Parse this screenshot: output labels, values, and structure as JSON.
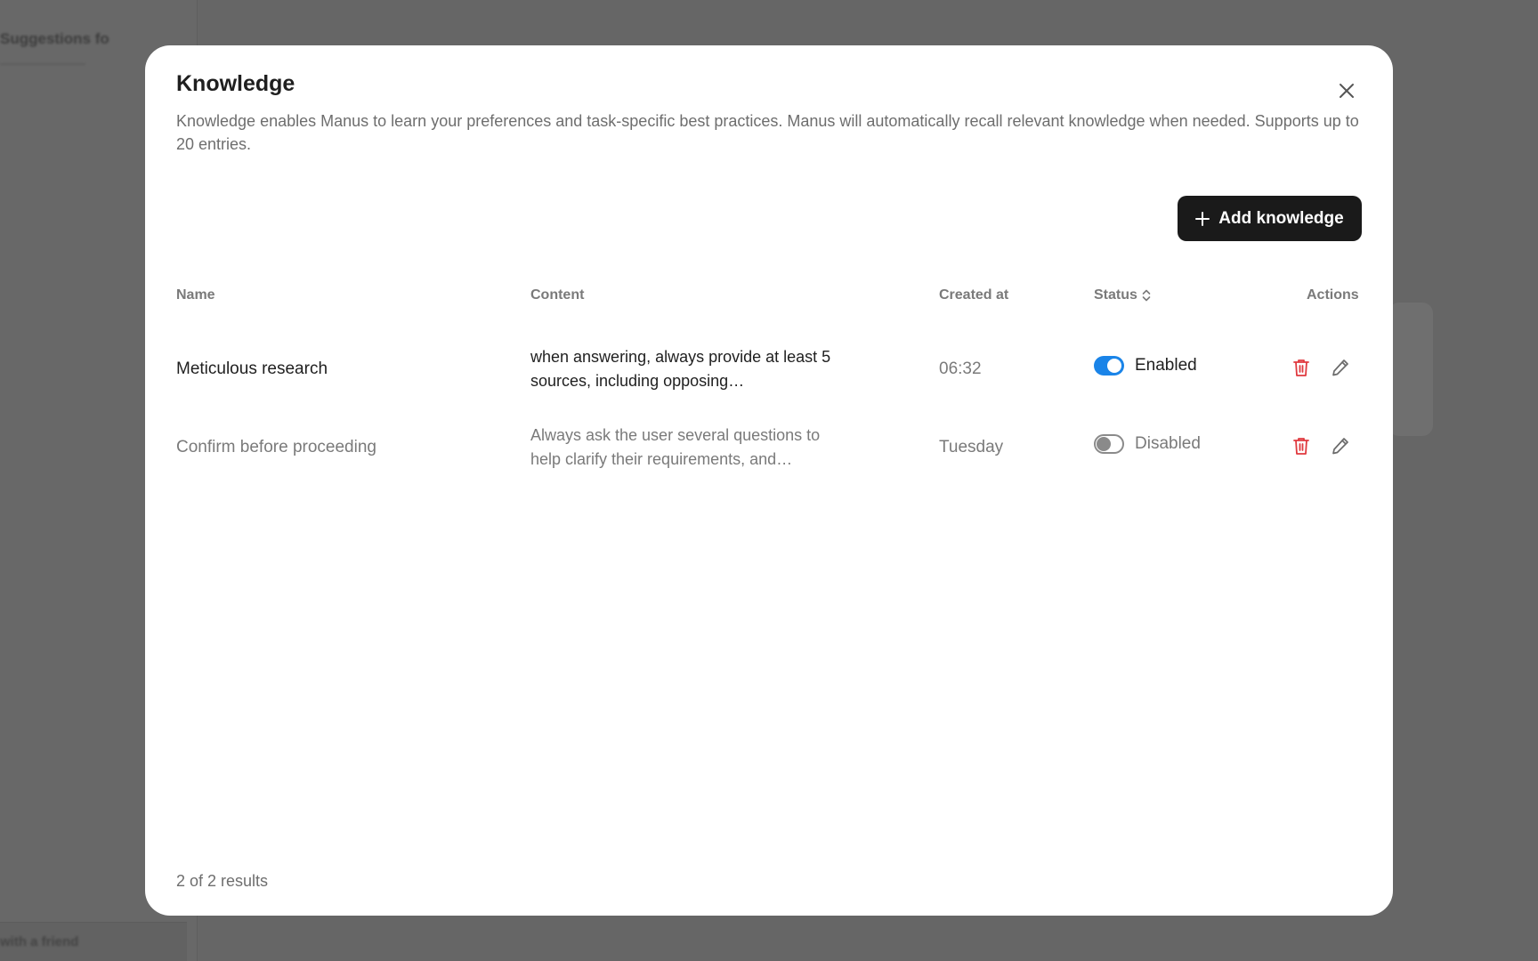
{
  "background": {
    "sidebar_title": "Suggestions fo",
    "bottom_label": "with a friend"
  },
  "modal": {
    "title": "Knowledge",
    "description": "Knowledge enables Manus to learn your preferences and task-specific best practices. Manus will automatically recall relevant knowledge when needed. Supports up to 20 entries.",
    "add_button_label": "Add knowledge",
    "close_icon": "close-icon"
  },
  "table": {
    "headers": {
      "name": "Name",
      "content": "Content",
      "created_at": "Created at",
      "status": "Status",
      "actions": "Actions"
    },
    "rows": [
      {
        "name": "Meticulous research",
        "content": "when answering, always provide at least 5 sources, including opposing…",
        "created_at": "06:32",
        "enabled": true,
        "status_label": "Enabled"
      },
      {
        "name": "Confirm before proceeding",
        "content": "Always ask the user several questions to help clarify their requirements, and…",
        "created_at": "Tuesday",
        "enabled": false,
        "status_label": "Disabled"
      }
    ]
  },
  "footer": {
    "results": "2 of 2 results"
  },
  "colors": {
    "accent": "#1a84e8",
    "delete": "#e0393e",
    "button_dark": "#1a1a1a"
  }
}
